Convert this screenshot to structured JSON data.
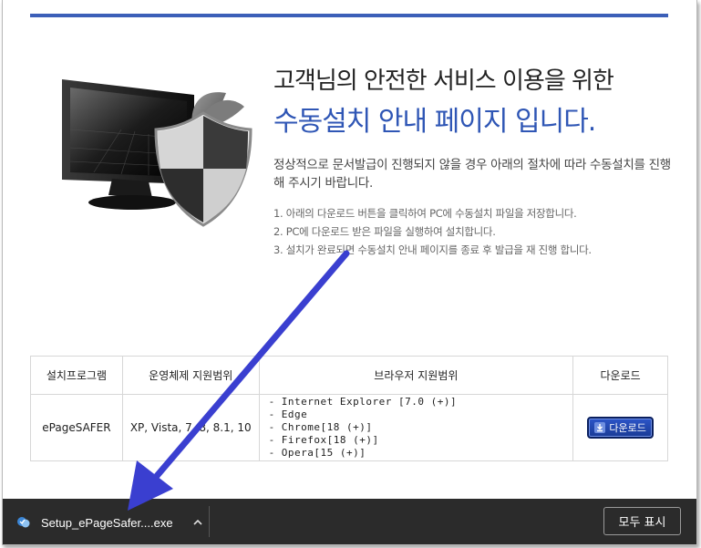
{
  "headline": {
    "line1": "고객님의 안전한 서비스 이용을 위한",
    "line2": "수동설치 안내 페이지 입니다."
  },
  "intro": "정상적으로 문서발급이 진행되지 않을 경우 아래의 절차에 따라 수동설치를 진행해 주시기 바랍니다.",
  "steps": [
    "1. 아래의 다운로드 버튼을 클릭하여 PC에 수동설치 파일을 저장합니다.",
    "2. PC에 다운로드 받은 파일을 실행하여 설치합니다.",
    "3. 설치가 완료되면 수동설치 안내 페이지를 종료 후 발급을 재 진행 합니다."
  ],
  "table": {
    "headers": [
      "설치프로그램",
      "운영체제 지원범위",
      "브라우저 지원범위",
      "다운로드"
    ],
    "row": {
      "program": "ePageSAFER",
      "os": "XP, Vista, 7, 8, 8.1, 10",
      "browsers": [
        "- Internet Explorer [7.0 (+)]",
        "- Edge",
        "- Chrome[18 (+)]",
        "- Firefox[18 (+)]",
        "- Opera[15 (+)]"
      ],
      "download_label": "다운로드"
    }
  },
  "download_bar": {
    "file_name": "Setup_ePageSafer....exe",
    "show_all_label": "모두 표시"
  },
  "colors": {
    "accent_blue": "#2f56b5",
    "annotation_arrow": "#3a3fd0",
    "download_bar_bg": "#2b2b2b"
  },
  "icons": {
    "hero": "monitor-with-shield-illustration",
    "download_button": "download-arrow-icon",
    "file": "setup-file-icon",
    "expand": "chevron-up-icon"
  }
}
